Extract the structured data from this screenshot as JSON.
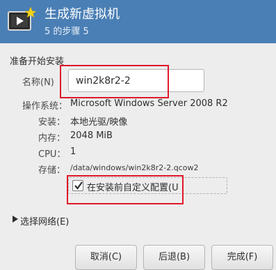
{
  "header": {
    "title": "生成新虚拟机",
    "subtitle": "5 的步骤 5"
  },
  "form": {
    "section_title": "准备开始安装",
    "name_label": "名称(N)",
    "name_value": "win2k8r2-2",
    "os_label": "操作系统：",
    "os_value": "Microsoft Windows Server 2008 R2",
    "install_label": "安装：",
    "install_value": "本地光驱/映像",
    "memory_label": "内存：",
    "memory_value": "2048 MiB",
    "cpu_label": "CPU：",
    "cpu_value": "1",
    "storage_label": "存储：",
    "storage_value": "/data/windows/win2k8r2-2.qcow2",
    "customize_label": "在安装前自定义配置(U",
    "customize_checked": true
  },
  "network": {
    "label": "选择网络(E)"
  },
  "buttons": {
    "cancel": "取消(C)",
    "back": "后退(B)",
    "finish": "完成(F)"
  },
  "colors": {
    "header_bg": "#4a7fb5",
    "highlight": "#e0182a"
  },
  "icons": {
    "app": "monitor-play-star-icon",
    "checkbox": "checkmark-icon",
    "network_toggle": "triangle-right-icon"
  }
}
